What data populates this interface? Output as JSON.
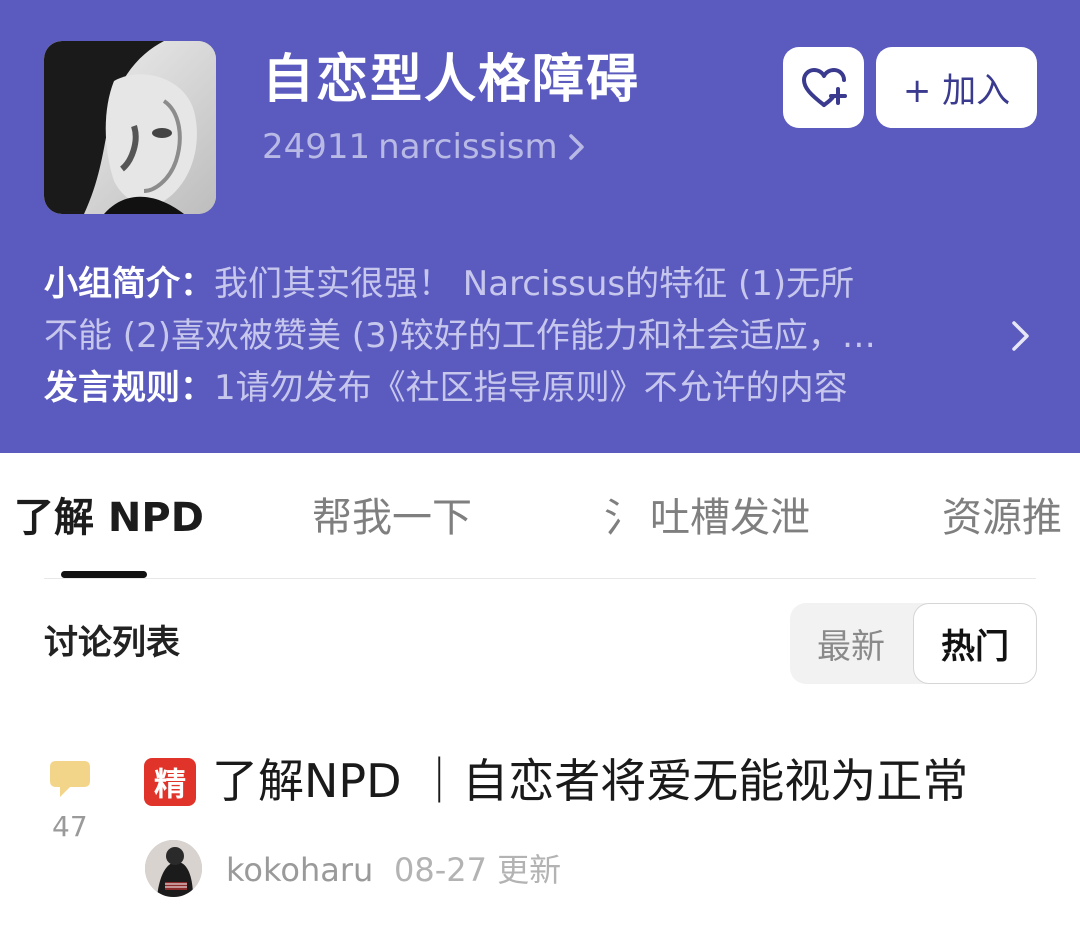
{
  "group": {
    "title": "自恋型人格障碍",
    "member_count": "24911",
    "slug": "narcissism",
    "fav_icon": "heart-plus-icon",
    "join_label": "+ 加入",
    "intro_label": "小组简介：",
    "intro_line1": "我们其实很强！   Narcissus的特征 (1)无所",
    "intro_line2": "不能 (2)喜欢被赞美 (3)较好的工作能力和社会适应，…",
    "rules_label": "发言规则：",
    "rules_text": "1请勿发布《社区指导原则》不允许的内容",
    "colors": {
      "header_bg": "#5b5bbf",
      "accent": "#e0342b"
    }
  },
  "tabs": [
    {
      "label": "了解 NPD",
      "active": true
    },
    {
      "label": "帮我一下",
      "active": false
    },
    {
      "label": "氵",
      "active": false
    },
    {
      "label": "吐槽发泄",
      "active": false
    },
    {
      "label": "资源推",
      "active": false
    }
  ],
  "discussion": {
    "title": "讨论列表",
    "sort_newest": "最新",
    "sort_hot": "热门",
    "selected_sort": "热门"
  },
  "post": {
    "comment_icon": "comment-icon",
    "comment_count": "47",
    "badge": "精",
    "title": "了解NPD ｜自恋者将爱无能视为正常",
    "author": "kokoharu",
    "time": "08-27 更新"
  }
}
